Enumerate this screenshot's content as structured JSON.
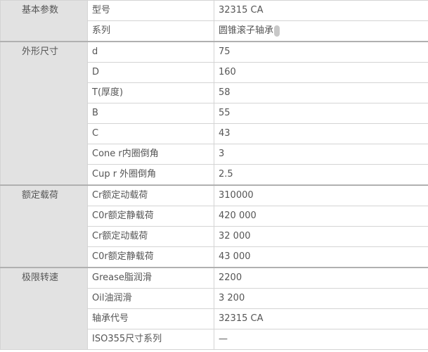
{
  "groups": [
    {
      "title": "基本参数",
      "rows": [
        {
          "label": "型号",
          "value": "32315 CA"
        },
        {
          "label": "系列",
          "value": "圆锥滚子轴承"
        }
      ]
    },
    {
      "title": "外形尺寸",
      "rows": [
        {
          "label": "d",
          "value": "75"
        },
        {
          "label": "D",
          "value": "160"
        },
        {
          "label": "T(厚度)",
          "value": "58"
        },
        {
          "label": "B",
          "value": "55"
        },
        {
          "label": "C",
          "value": "43"
        },
        {
          "label": "Cone r内圈倒角",
          "value": "3"
        },
        {
          "label": "Cup r 外圈倒角",
          "value": "2.5"
        }
      ]
    },
    {
      "title": "额定载荷",
      "rows": [
        {
          "label": "Cr额定动载荷",
          "value": "310000"
        },
        {
          "label": "C0r额定静载荷",
          "value": "420 000"
        },
        {
          "label": "Cr额定动载荷",
          "value": "32 000"
        },
        {
          "label": "C0r额定静载荷",
          "value": "43 000"
        }
      ]
    },
    {
      "title": "极限转速",
      "rows": [
        {
          "label": "Grease脂润滑",
          "value": "2200"
        },
        {
          "label": "Oil油润滑",
          "value": "3 200"
        },
        {
          "label": "轴承代号",
          "value": "32315 CA"
        },
        {
          "label": "ISO355尺寸系列",
          "value": "—"
        }
      ]
    }
  ]
}
